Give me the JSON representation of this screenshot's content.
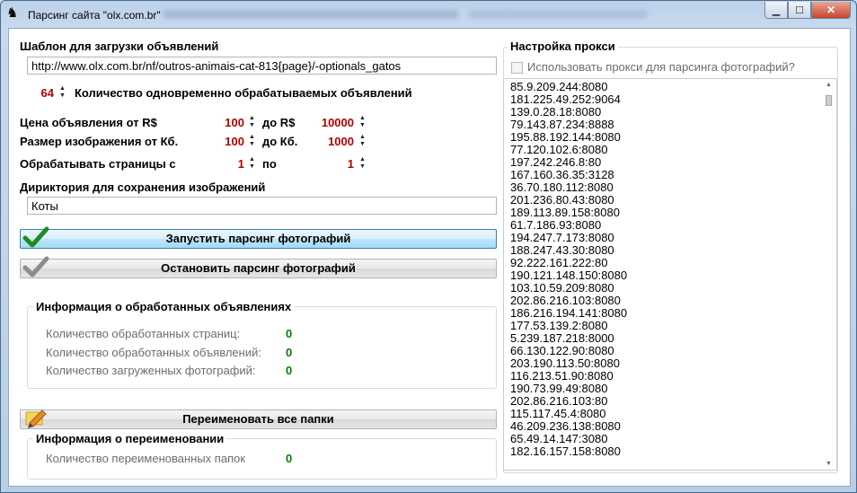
{
  "window": {
    "title": "Парсинг сайта \"olx.com.br\"",
    "buttons": {
      "minimize": "▁",
      "maximize": "☐",
      "close": "✕"
    }
  },
  "template": {
    "label": "Шаблон для загрузки объявлений",
    "url": "http://www.olx.com.br/nf/outros-animais-cat-813{page}/-optionals_gatos"
  },
  "concurrent": {
    "value": "64",
    "label": "Количество одновременно обрабатываемых объявлений"
  },
  "price": {
    "label": "Цена объявления от R$",
    "from": "100",
    "to_label": "до R$",
    "to": "10000"
  },
  "size": {
    "label": "Размер изображения от Кб.",
    "from": "100",
    "to_label": "до Кб.",
    "to": "1000"
  },
  "pages": {
    "label": "Обрабатывать страницы с",
    "from": "1",
    "to_label": "по",
    "to": "1"
  },
  "directory": {
    "label": "Дириктория для сохранения изображений",
    "value": "Коты"
  },
  "buttons": {
    "start": "Запустить парсинг фотографий",
    "stop": "Остановить парсинг фотографий",
    "rename": "Переименовать все папки"
  },
  "info": {
    "title": "Информация о обработанных объявлениях",
    "pages_label": "Количество обработанных страниц:",
    "pages_value": "0",
    "ads_label": "Количество обработанных объявлений:",
    "ads_value": "0",
    "photos_label": "Количество загруженных фотографий:",
    "photos_value": "0"
  },
  "rename_info": {
    "title": "Информация о переименовании",
    "folders_label": "Количество переименованных папок",
    "folders_value": "0"
  },
  "proxy": {
    "title": "Настройка прокси",
    "use_label": "Использовать прокси для парсинга фотографий?",
    "use_checked": false,
    "list": [
      "85.9.209.244:8080",
      "181.225.49.252:9064",
      "139.0.28.18:8080",
      "79.143.87.234:8888",
      "195.88.192.144:8080",
      "77.120.102.6:8080",
      "197.242.246.8:80",
      "167.160.36.35:3128",
      "36.70.180.112:8080",
      "201.236.80.43:8080",
      "189.113.89.158:8080",
      "61.7.186.93:8080",
      "194.247.7.173:8080",
      "188.247.43.30:8080",
      "92.222.161.222:80",
      "190.121.148.150:8080",
      "103.10.59.209:8080",
      "202.86.216.103:8080",
      "186.216.194.141:8080",
      "177.53.139.2:8080",
      "5.239.187.218:8000",
      "66.130.122.90:8080",
      "203.190.113.50:8080",
      "116.213.51.90:8080",
      "190.73.99.49:8080",
      "202.86.216.103:80",
      "115.117.45.4:8080",
      "46.209.236.138:8080",
      "65.49.14.147:3080",
      "182.16.157.158:8080"
    ]
  }
}
